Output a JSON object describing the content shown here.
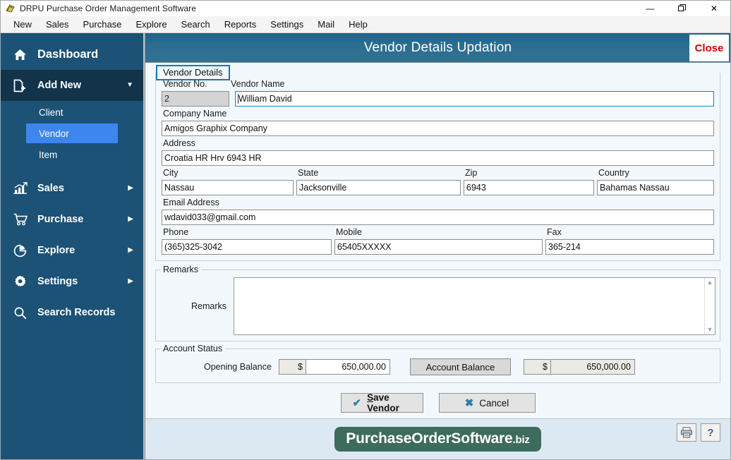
{
  "window": {
    "title": "DRPU Purchase Order Management Software",
    "icon": "app-icon",
    "controls": {
      "minimize": "—",
      "restore": "❐",
      "close": "✕"
    }
  },
  "menubar": {
    "items": [
      "New",
      "Sales",
      "Purchase",
      "Explore",
      "Search",
      "Reports",
      "Settings",
      "Mail",
      "Help"
    ]
  },
  "sidebar": {
    "items": [
      {
        "label": "Dashboard",
        "icon": "home-icon",
        "arrow": ""
      },
      {
        "label": "Add New",
        "icon": "file-plus-icon",
        "arrow": "▼"
      },
      {
        "label": "Sales",
        "icon": "bar-chart-icon",
        "arrow": "▶"
      },
      {
        "label": "Purchase",
        "icon": "cart-icon",
        "arrow": "▶"
      },
      {
        "label": "Explore",
        "icon": "pie-chart-icon",
        "arrow": "▶"
      },
      {
        "label": "Settings",
        "icon": "gear-icon",
        "arrow": "▶"
      },
      {
        "label": "Search Records",
        "icon": "magnifier-icon",
        "arrow": ""
      }
    ],
    "subitems": [
      {
        "label": "Client",
        "selected": false
      },
      {
        "label": "Vendor",
        "selected": true
      },
      {
        "label": "Item",
        "selected": false
      }
    ]
  },
  "form": {
    "title": "Vendor Details Updation",
    "close_label": "Close",
    "tab_label": "Vendor Details",
    "labels": {
      "vendor_no": "Vendor No.",
      "vendor_name": "Vendor Name",
      "company_name": "Company Name",
      "address": "Address",
      "city": "City",
      "state": "State",
      "zip": "Zip",
      "country": "Country",
      "email": "Email Address",
      "phone": "Phone",
      "mobile": "Mobile",
      "fax": "Fax",
      "remarks_group": "Remarks",
      "remarks_field": "Remarks",
      "account_status": "Account Status",
      "opening_balance": "Opening Balance"
    },
    "values": {
      "vendor_no": "2",
      "vendor_name": "William David",
      "company_name": "Amigos Graphix Company",
      "address": "Croatia HR Hrv 6943 HR",
      "city": "Nassau",
      "state": "Jacksonville",
      "zip": "6943",
      "country": "Bahamas  Nassau",
      "email": "wdavid033@gmail.com",
      "phone": "(365)325-3042",
      "mobile": "65405XXXXX",
      "fax": "365-214",
      "remarks": "",
      "opening_currency": "$",
      "opening_balance": "650,000.00",
      "account_currency": "$",
      "account_balance": "650,000.00"
    },
    "buttons": {
      "account_balance": "Account Balance",
      "save_accel": "S",
      "save_rest": "ave Vendor",
      "cancel": "Cancel"
    }
  },
  "footer": {
    "brand_name": "PurchaseOrderSoftware",
    "brand_tld": ".biz",
    "print_icon": "printer-icon",
    "help_icon": "question-mark-icon"
  },
  "colors": {
    "sidebar_bg": "#1b5275",
    "sidebar_active": "#123349",
    "sub_selected": "#3d86ef",
    "header_blue": "#2c6e92",
    "close_red": "#d00000",
    "brand_green": "#3d6b5c",
    "tab_border": "#1a79a8"
  }
}
